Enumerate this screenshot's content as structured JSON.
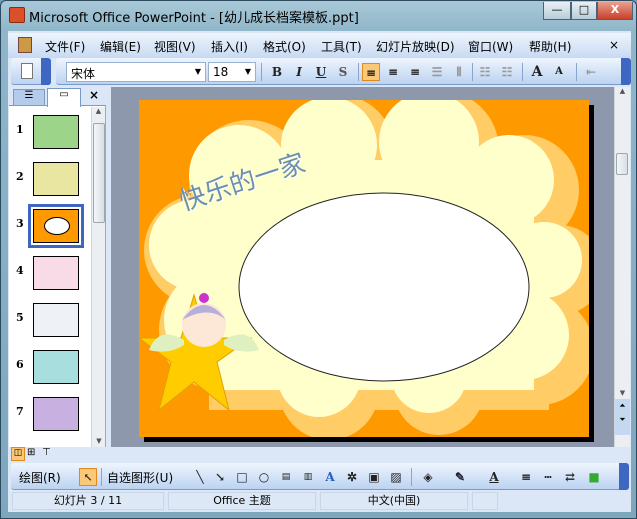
{
  "window": {
    "title": "Microsoft Office PowerPoint - [幼儿成长档案模板.ppt]",
    "minimize": "—",
    "maximize": "□",
    "close": "X"
  },
  "menu": [
    "文件(F)",
    "编辑(E)",
    "视图(V)",
    "插入(I)",
    "格式(O)",
    "工具(T)",
    "幻灯片放映(D)",
    "窗口(W)",
    "帮助(H)"
  ],
  "menu_close": "×",
  "format_toolbar": {
    "font": "宋体",
    "size": "18",
    "bold": "B",
    "italic": "I",
    "underline": "U",
    "shadow": "S",
    "grow": "A",
    "shrink": "A"
  },
  "slides_pane": {
    "numbers": [
      "1",
      "2",
      "3",
      "4",
      "5",
      "6",
      "7"
    ],
    "selected": 3,
    "close": "×"
  },
  "slide": {
    "title": "快乐的一家",
    "background": "#ff9900",
    "cloud": "#ffffcc"
  },
  "drawing_toolbar": {
    "draw": "绘图(R)",
    "autoshapes": "自选图形(U)"
  },
  "status": {
    "slide": "幻灯片 3 / 11",
    "theme": "Office 主题",
    "language": "中文(中国)"
  }
}
